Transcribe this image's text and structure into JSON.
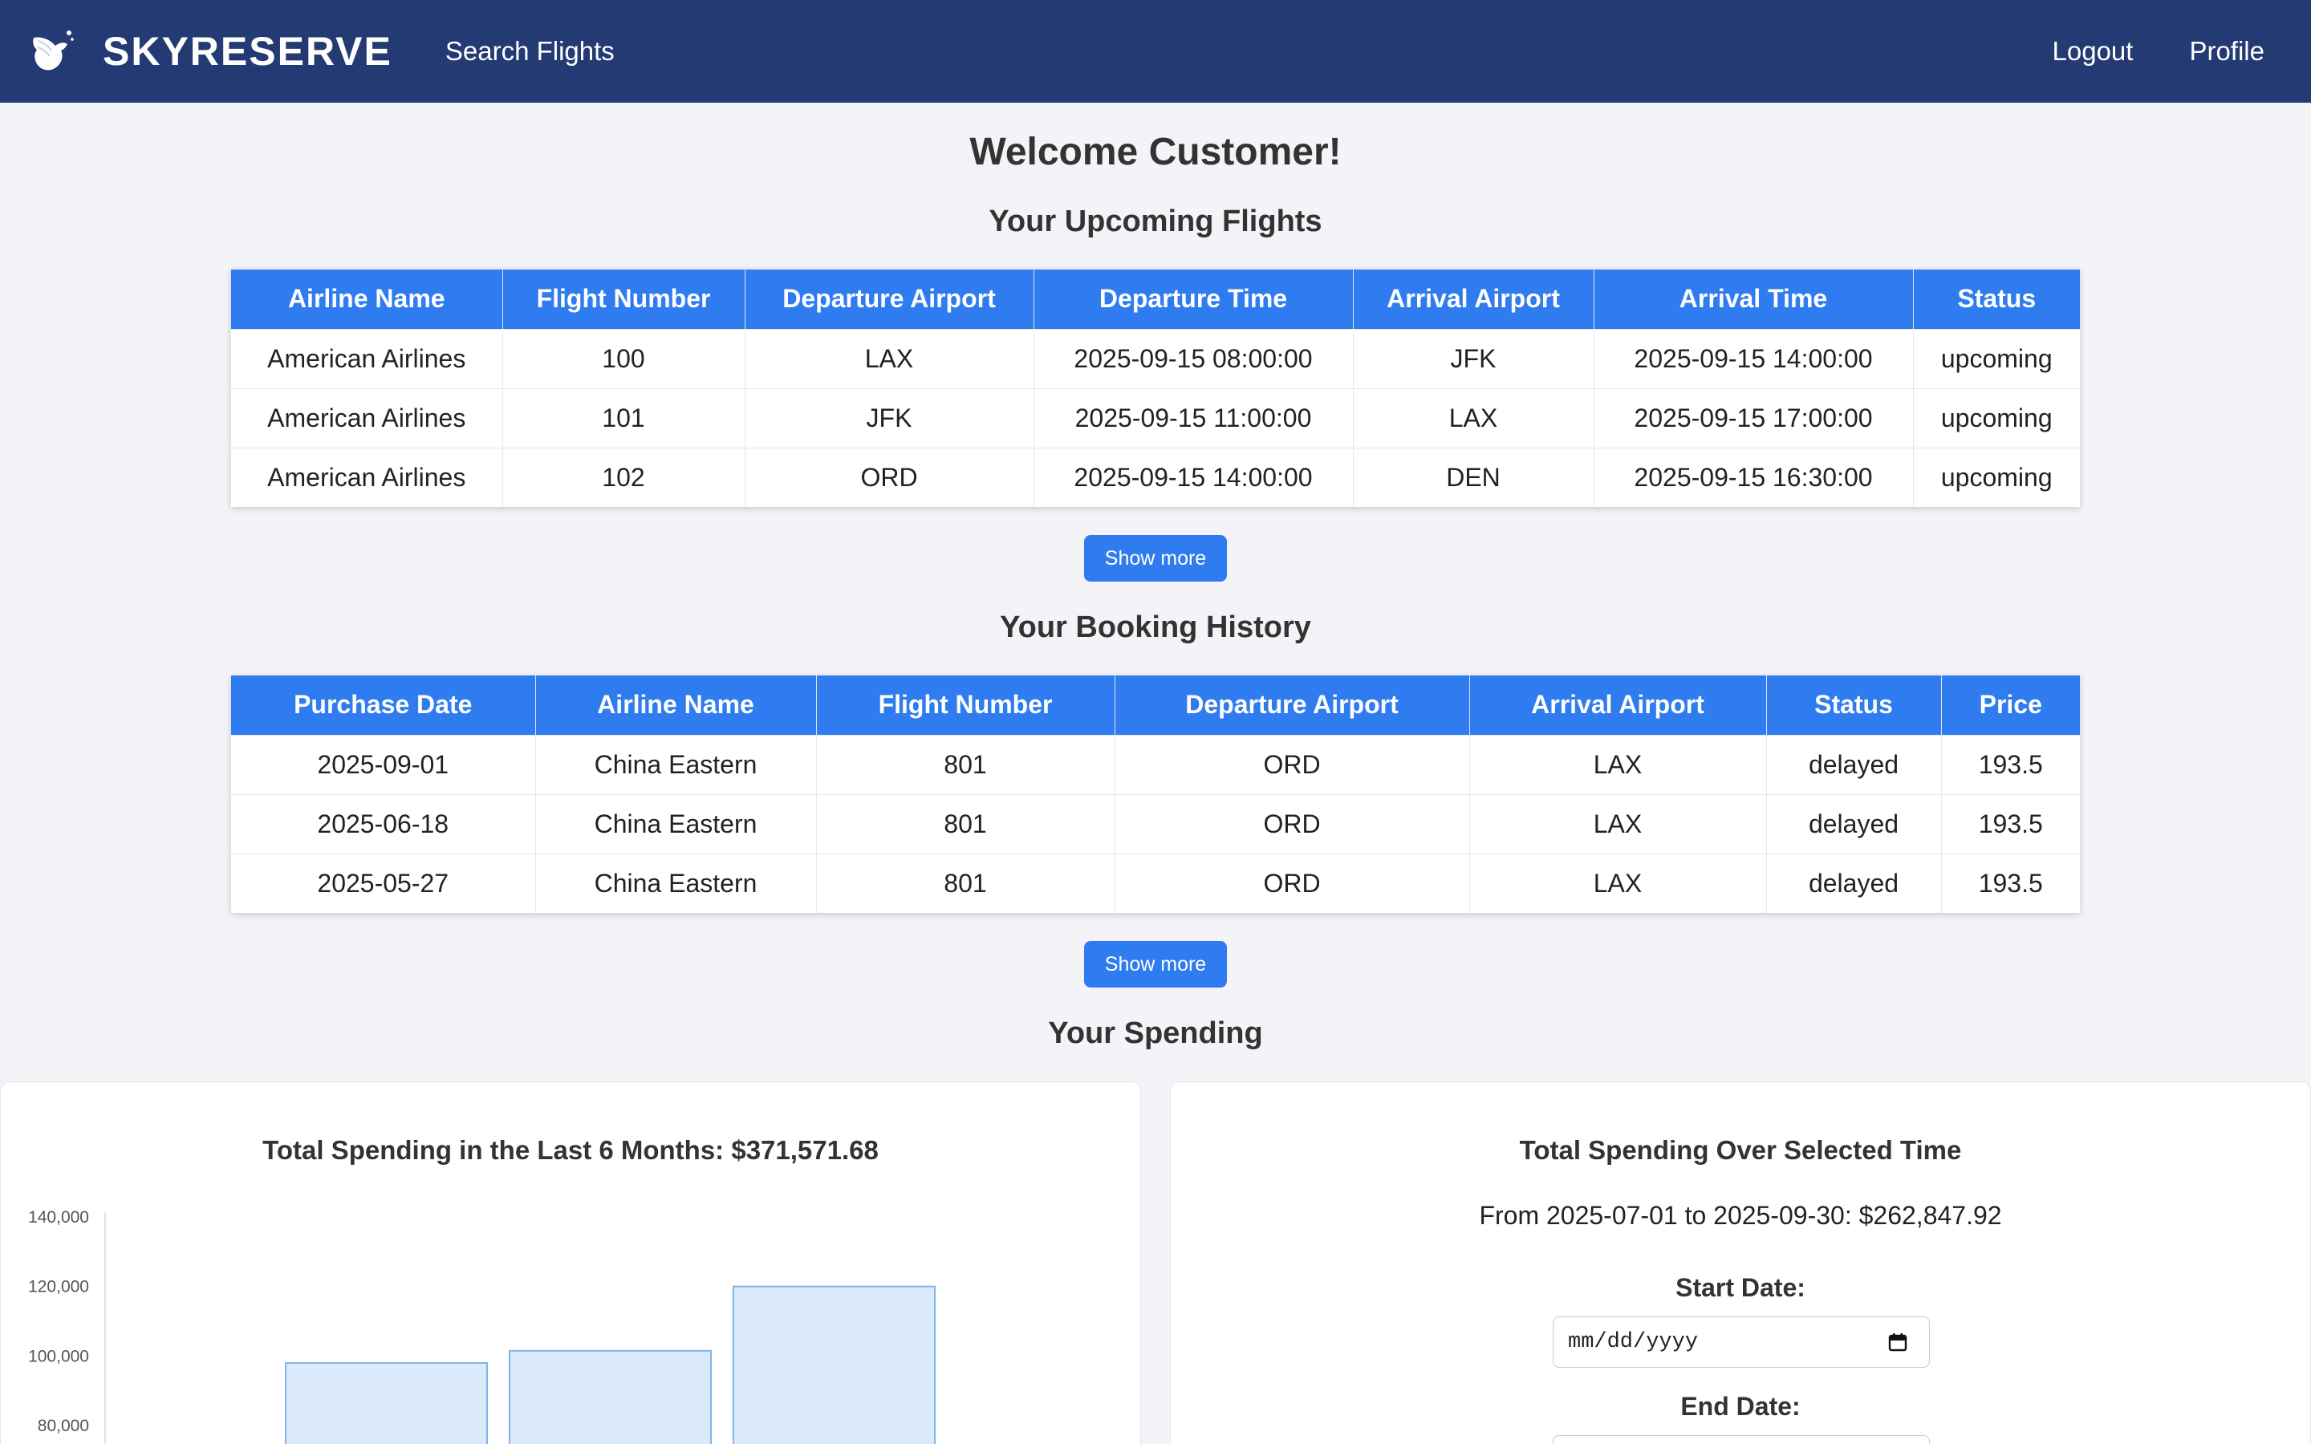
{
  "nav": {
    "brand": "SKYRESERVE",
    "search_flights": "Search Flights",
    "logout": "Logout",
    "profile": "Profile"
  },
  "welcome": "Welcome Customer!",
  "upcoming": {
    "title": "Your Upcoming Flights",
    "headers": [
      "Airline Name",
      "Flight Number",
      "Departure Airport",
      "Departure Time",
      "Arrival Airport",
      "Arrival Time",
      "Status"
    ],
    "rows": [
      [
        "American Airlines",
        "100",
        "LAX",
        "2025-09-15 08:00:00",
        "JFK",
        "2025-09-15 14:00:00",
        "upcoming"
      ],
      [
        "American Airlines",
        "101",
        "JFK",
        "2025-09-15 11:00:00",
        "LAX",
        "2025-09-15 17:00:00",
        "upcoming"
      ],
      [
        "American Airlines",
        "102",
        "ORD",
        "2025-09-15 14:00:00",
        "DEN",
        "2025-09-15 16:30:00",
        "upcoming"
      ]
    ],
    "show_more": "Show more"
  },
  "history": {
    "title": "Your Booking History",
    "headers": [
      "Purchase Date",
      "Airline Name",
      "Flight Number",
      "Departure Airport",
      "Arrival Airport",
      "Status",
      "Price"
    ],
    "rows": [
      [
        "2025-09-01",
        "China Eastern",
        "801",
        "ORD",
        "LAX",
        "delayed",
        "193.5"
      ],
      [
        "2025-06-18",
        "China Eastern",
        "801",
        "ORD",
        "LAX",
        "delayed",
        "193.5"
      ],
      [
        "2025-05-27",
        "China Eastern",
        "801",
        "ORD",
        "LAX",
        "delayed",
        "193.5"
      ]
    ],
    "show_more": "Show more"
  },
  "spending": {
    "title": "Your Spending",
    "six_month_title": "Total Spending in the Last 6 Months: $371,571.68",
    "selected_title": "Total Spending Over Selected Time",
    "range_text": "From 2025-07-01 to 2025-09-30: $262,847.92",
    "start_label": "Start Date:",
    "end_label": "End Date:",
    "start_placeholder": "mm/dd/yyyy"
  },
  "chart_data": {
    "type": "bar",
    "title": "",
    "xlabel": "",
    "ylabel": "",
    "y_ticks": [
      80000,
      100000,
      120000,
      140000
    ],
    "ylim": [
      0,
      140000
    ],
    "categories": [
      "",
      "",
      ""
    ],
    "values": [
      98000,
      101500,
      120000
    ],
    "colors": {
      "fill": "#dbeafb",
      "stroke": "#7fb6e9"
    }
  },
  "colors": {
    "navbar": "#243a73",
    "accent": "#2f7cf0",
    "background": "#f4f3f8"
  }
}
